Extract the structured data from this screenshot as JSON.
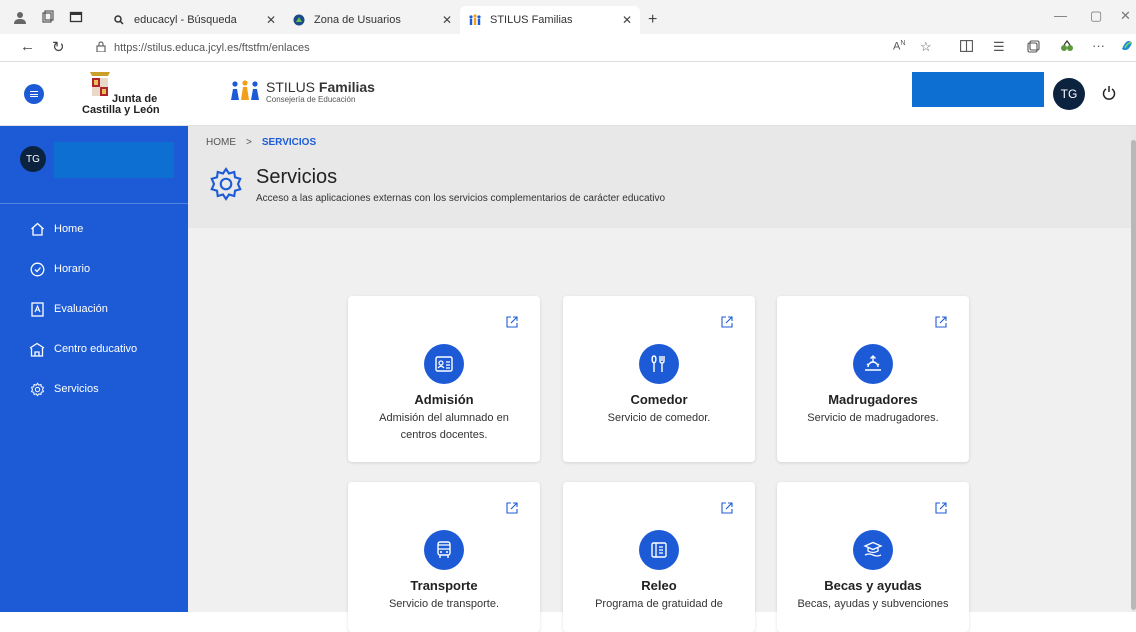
{
  "browser": {
    "tabs": [
      {
        "label": "educacyl - Búsqueda"
      },
      {
        "label": "Zona de Usuarios"
      },
      {
        "label": "STILUS Familias"
      }
    ],
    "new_tab": "+",
    "url": "https://stilus.educa.jcyl.es/ftstfm/enlaces"
  },
  "header": {
    "org_line1": "Junta de",
    "org_line2": "Castilla y León",
    "app_name_prefix": "STILUS",
    "app_name_bold": "Familias",
    "app_subtitle": "Consejería de Educación",
    "avatar_initials": "TG"
  },
  "sidebar": {
    "avatar_initials": "TG",
    "items": [
      {
        "label": "Home",
        "icon": "home-icon"
      },
      {
        "label": "Horario",
        "icon": "clock-icon"
      },
      {
        "label": "Evaluación",
        "icon": "report-icon"
      },
      {
        "label": "Centro educativo",
        "icon": "school-icon"
      },
      {
        "label": "Servicios",
        "icon": "gear-icon"
      }
    ]
  },
  "page": {
    "breadcrumb": [
      "HOME",
      "SERVICIOS"
    ],
    "breadcrumb_sep": ">",
    "title": "Servicios",
    "subtitle": "Acceso a las aplicaciones externas con los servicios complementarios de carácter educativo"
  },
  "services": [
    {
      "title": "Admisión",
      "desc": "Admisión del alumnado en centros docentes.",
      "icon": "admission-icon"
    },
    {
      "title": "Comedor",
      "desc": "Servicio de comedor.",
      "icon": "cutlery-icon"
    },
    {
      "title": "Madrugadores",
      "desc": "Servicio de madrugadores.",
      "icon": "sunrise-icon"
    },
    {
      "title": "Transporte",
      "desc": "Servicio de transporte.",
      "icon": "bus-icon"
    },
    {
      "title": "Releo",
      "desc": "Programa de gratuidad de",
      "icon": "book-icon"
    },
    {
      "title": "Becas y ayudas",
      "desc": "Becas, ayudas y subvenciones",
      "icon": "scholarship-icon"
    }
  ],
  "colors": {
    "primary": "#1d5bd6",
    "redaction": "#0d6fd1",
    "avatar": "#0c2340"
  }
}
